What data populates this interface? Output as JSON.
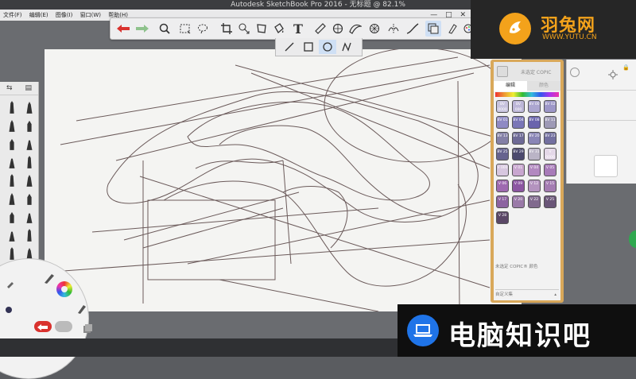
{
  "window": {
    "title": "Autodesk SketchBook Pro 2016 - 无标题 @ 82.1%",
    "controls": [
      "—",
      "□",
      "✕"
    ]
  },
  "menu": {
    "items": [
      "文件(F)",
      "编辑(E)",
      "图像(I)",
      "窗口(W)",
      "帮助(H)"
    ]
  },
  "toolbar": {
    "buttons": [
      "undo-icon",
      "redo-icon",
      "zoom-icon",
      "select-icon",
      "lasso-select-icon",
      "crop-icon",
      "transform-icon",
      "distort-icon",
      "fill-icon",
      "text-icon",
      "ruler-icon",
      "ellipse-guide-icon",
      "french-curve-icon",
      "perspective-icon",
      "symmetry-icon",
      "stroke-tool-icon",
      "layer-editor-icon",
      "brush-palette-icon",
      "copic-library-icon"
    ],
    "text_label": "T"
  },
  "shape_bar": {
    "buttons": [
      "line-icon",
      "rectangle-icon",
      "ellipse-icon",
      "polyline-icon"
    ],
    "active": "ellipse-icon"
  },
  "brush_panel": {
    "header_icons": [
      "swap-icon",
      "brush-list-icon"
    ]
  },
  "copic": {
    "header_title": "未选定 COPIC",
    "tabs": [
      "编辑",
      "颜色"
    ],
    "active_tab": "编辑",
    "swatches": [
      {
        "code": "BV 0000",
        "color": "#c7c3de"
      },
      {
        "code": "BV 000",
        "color": "#bdb7d8"
      },
      {
        "code": "BV 00",
        "color": "#aca6d0"
      },
      {
        "code": "BV 02",
        "color": "#9d97c8"
      },
      {
        "code": "BV 01",
        "color": "#8f8ac4"
      },
      {
        "code": "BV 04",
        "color": "#7a76b7"
      },
      {
        "code": "BV 08",
        "color": "#6a64ad"
      },
      {
        "code": "BV 11",
        "color": "#9e9ab6"
      },
      {
        "code": "BV 13",
        "color": "#8480a6"
      },
      {
        "code": "BV 17",
        "color": "#6e6a96"
      },
      {
        "code": "BV 20",
        "color": "#8a86b6"
      },
      {
        "code": "BV 23",
        "color": "#7370a0"
      },
      {
        "code": "BV 25",
        "color": "#66638f"
      },
      {
        "code": "BV 29",
        "color": "#4c4a6e"
      },
      {
        "code": "BV 31",
        "color": "#bab4c6"
      },
      {
        "code": "V 0000",
        "color": "#e4d8e8"
      },
      {
        "code": "V 000",
        "color": "#d7c7df"
      },
      {
        "code": "V 01",
        "color": "#c8a6cf"
      },
      {
        "code": "V 04",
        "color": "#b289c0"
      },
      {
        "code": "V 05",
        "color": "#a87bb9"
      },
      {
        "code": "V 06",
        "color": "#9e6ab0"
      },
      {
        "code": "V 09",
        "color": "#8c56a2"
      },
      {
        "code": "V 12",
        "color": "#b493bf"
      },
      {
        "code": "V 15",
        "color": "#a47cb2"
      },
      {
        "code": "V 17",
        "color": "#8c63a0"
      },
      {
        "code": "V 20",
        "color": "#9a7aa8"
      },
      {
        "code": "V 22",
        "color": "#816a8e"
      },
      {
        "code": "V 25",
        "color": "#6a5678"
      },
      {
        "code": "V 28",
        "color": "#5a4766"
      }
    ],
    "footer_note": "未选定 COPIC® 颜色",
    "custom_label": "自定义集"
  },
  "watermarks": {
    "top_name": "羽兔网",
    "top_url": "WWW.YUTU.CN",
    "bottom_text": "电脑知识吧"
  },
  "colors": {
    "canvas": "#f4f4f2",
    "copic_frame": "#d9a85a",
    "brand_orange": "#f3a21b",
    "brand_blue": "#1f74e8",
    "sketch_stroke": "#6b5a5a"
  }
}
